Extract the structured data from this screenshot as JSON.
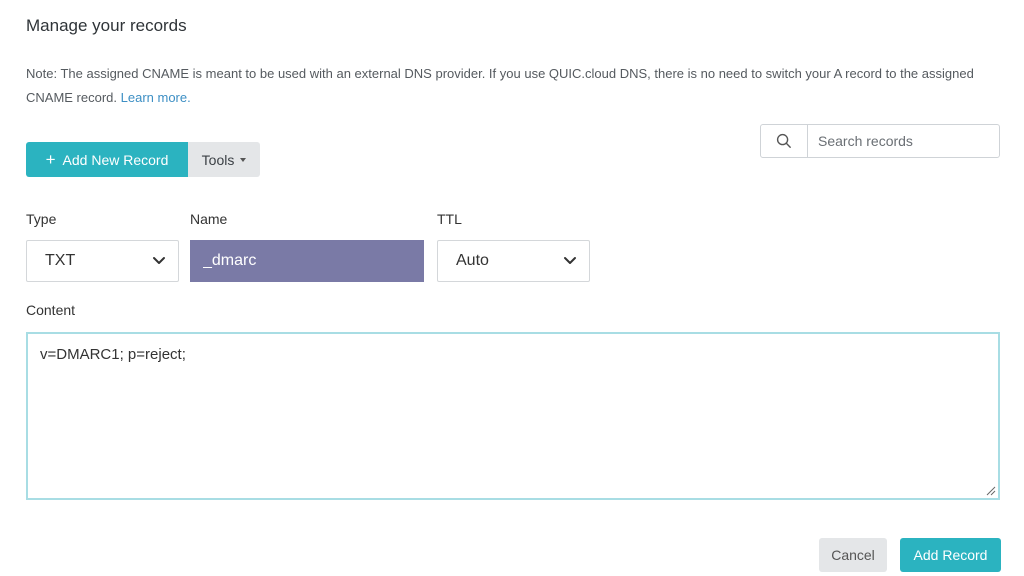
{
  "page": {
    "title": "Manage your records",
    "note_text": "Note: The assigned CNAME is meant to be used with an external DNS provider. If you use QUIC.cloud DNS, there is no need to switch your A record to the assigned CNAME record. ",
    "note_link": "Learn more."
  },
  "toolbar": {
    "add_new_label": "Add New Record",
    "add_new_icon": "plus-icon",
    "tools_label": "Tools",
    "tools_icon": "caret-down-icon"
  },
  "search": {
    "icon": "search-icon",
    "placeholder": "Search records",
    "value": ""
  },
  "form": {
    "type_label": "Type",
    "type_value": "TXT",
    "name_label": "Name",
    "name_value": "_dmarc",
    "ttl_label": "TTL",
    "ttl_value": "Auto",
    "content_label": "Content",
    "content_value": "v=DMARC1; p=reject;"
  },
  "actions": {
    "cancel_label": "Cancel",
    "add_record_label": "Add Record"
  },
  "colors": {
    "accent": "#2bb3c0",
    "name_field_bg": "#7a7aa6",
    "secondary_button": "#e4e6e8",
    "link": "#3d8fc4",
    "content_border": "#a8dde4"
  }
}
